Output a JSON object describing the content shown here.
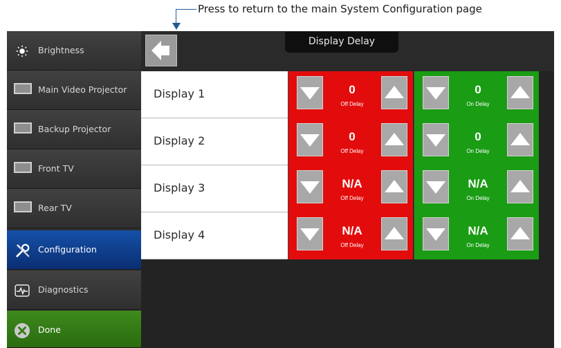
{
  "callout": {
    "text": "Press to return to the main System Configuration page"
  },
  "sidebar": {
    "items": [
      {
        "label": "Brightness",
        "icon": "sun-icon"
      },
      {
        "label": "Main Video Projector",
        "icon": "screen-icon"
      },
      {
        "label": "Backup Projector",
        "icon": "screen-icon"
      },
      {
        "label": "Front TV",
        "icon": "screen-icon"
      },
      {
        "label": "Rear TV",
        "icon": "screen-icon"
      },
      {
        "label": "Configuration",
        "icon": "wrench-screwdriver-icon",
        "active": true
      },
      {
        "label": "Diagnostics",
        "icon": "pulse-monitor-icon"
      },
      {
        "label": "Done",
        "icon": "close-circle-icon"
      }
    ]
  },
  "header": {
    "title": "Display Delay",
    "back_icon": "back-arrow-icon"
  },
  "displays": [
    {
      "name": "Display 1",
      "off_value": "0",
      "off_label": "Off Delay",
      "on_value": "0",
      "on_label": "On Delay"
    },
    {
      "name": "Display 2",
      "off_value": "0",
      "off_label": "Off Delay",
      "on_value": "0",
      "on_label": "On Delay"
    },
    {
      "name": "Display 3",
      "off_value": "N/A",
      "off_label": "Off Delay",
      "on_value": "N/A",
      "on_label": "On Delay"
    },
    {
      "name": "Display 4",
      "off_value": "N/A",
      "off_label": "Off Delay",
      "on_value": "N/A",
      "on_label": "On Delay"
    }
  ],
  "colors": {
    "off": "#e30c0c",
    "on": "#1a9c14",
    "active_nav": "#1550a8",
    "done": "#3e8a1d"
  }
}
